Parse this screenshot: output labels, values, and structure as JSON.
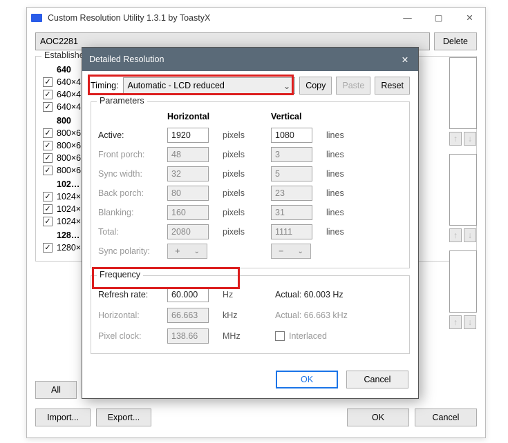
{
  "app": {
    "title": "Custom Resolution Utility 1.3.1 by ToastyX",
    "minimize": "—",
    "maximize": "▢",
    "close": "✕"
  },
  "monitor": {
    "name": "AOC2281",
    "delete_btn": "Delete"
  },
  "estab": {
    "legend": "Established",
    "groups": [
      {
        "header": "640",
        "items": [
          "640×4…",
          "640×4…",
          "640×4…"
        ]
      },
      {
        "header": "800",
        "items": [
          "800×6…",
          "800×6…",
          "800×6…",
          "800×6…"
        ]
      },
      {
        "header": "102…",
        "items": [
          "1024×…",
          "1024×…",
          "1024×…"
        ]
      },
      {
        "header": "128…",
        "items": [
          "1280×…"
        ]
      }
    ]
  },
  "bottom": {
    "all": "All",
    "import": "Import...",
    "export": "Export...",
    "ok": "OK",
    "cancel": "Cancel"
  },
  "side_arrows": {
    "up": "↑",
    "down": "↓"
  },
  "dialog": {
    "title": "Detailed Resolution",
    "close": "✕",
    "timing_label": "Timing:",
    "timing_value": "Automatic - LCD reduced",
    "copy": "Copy",
    "paste": "Paste",
    "reset": "Reset",
    "params": {
      "legend": "Parameters",
      "h_hdr": "Horizontal",
      "v_hdr": "Vertical",
      "rows": [
        {
          "label": "Active:",
          "h": "1920",
          "hu": "pixels",
          "v": "1080",
          "vu": "lines",
          "active": true
        },
        {
          "label": "Front porch:",
          "h": "48",
          "hu": "pixels",
          "v": "3",
          "vu": "lines",
          "active": false
        },
        {
          "label": "Sync width:",
          "h": "32",
          "hu": "pixels",
          "v": "5",
          "vu": "lines",
          "active": false
        },
        {
          "label": "Back porch:",
          "h": "80",
          "hu": "pixels",
          "v": "23",
          "vu": "lines",
          "active": false
        },
        {
          "label": "Blanking:",
          "h": "160",
          "hu": "pixels",
          "v": "31",
          "vu": "lines",
          "active": false
        },
        {
          "label": "Total:",
          "h": "2080",
          "hu": "pixels",
          "v": "1111",
          "vu": "lines",
          "active": false
        }
      ],
      "polarity_label": "Sync polarity:",
      "pol_h": "+",
      "pol_v": "−"
    },
    "freq": {
      "legend": "Frequency",
      "rows": [
        {
          "label": "Refresh rate:",
          "val": "60.000",
          "unit": "Hz",
          "actual": "Actual: 60.003 Hz",
          "active": true
        },
        {
          "label": "Horizontal:",
          "val": "66.663",
          "unit": "kHz",
          "actual": "Actual: 66.663 kHz",
          "active": false
        },
        {
          "label": "Pixel clock:",
          "val": "138.66",
          "unit": "MHz",
          "actual": "",
          "active": false
        }
      ],
      "interlaced_label": "Interlaced"
    },
    "ok": "OK",
    "cancel": "Cancel"
  }
}
